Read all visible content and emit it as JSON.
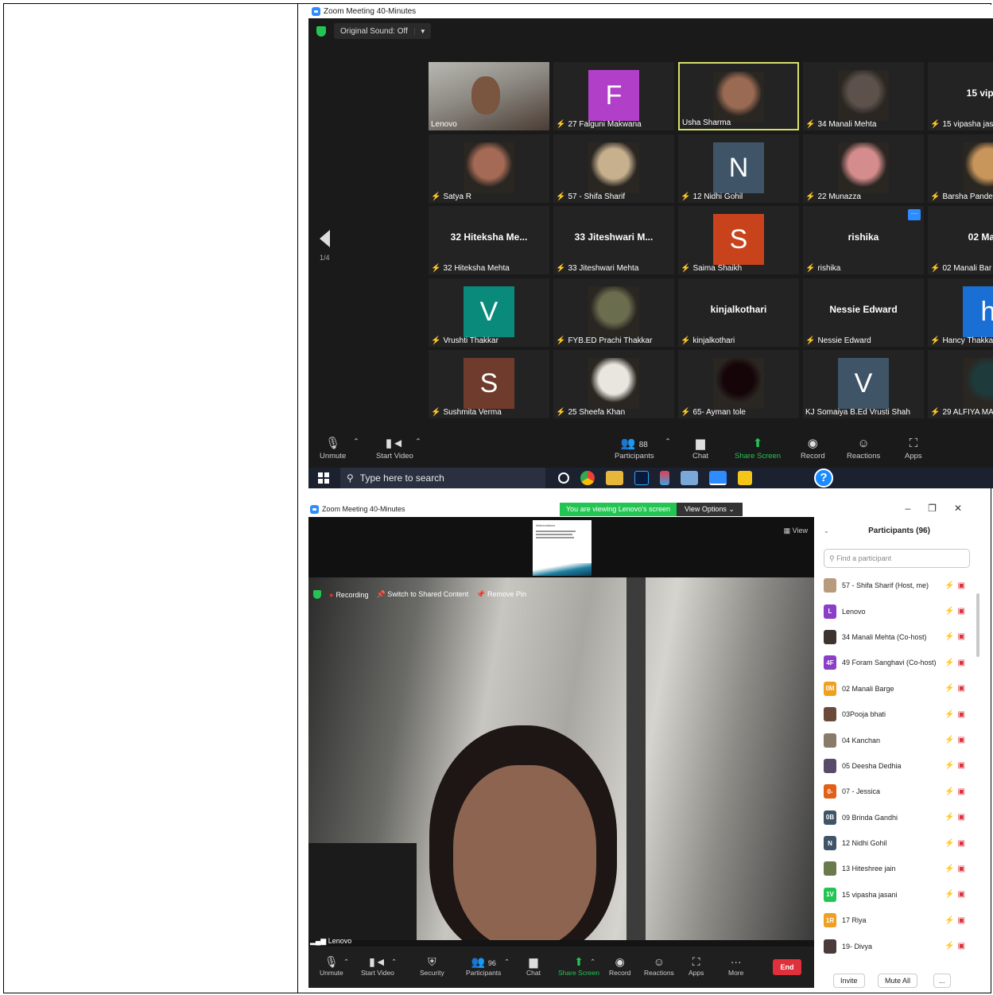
{
  "top": {
    "window_title": "Zoom Meeting 40-Minutes",
    "original_sound": "Original Sound: Off",
    "page_indicator": "1/4",
    "tiles": [
      {
        "name": "Lenovo",
        "kind": "photo-wide",
        "muted": false
      },
      {
        "name": "27 Falguni Makwana",
        "kind": "letter",
        "letter": "F",
        "color": "#b13fc8",
        "muted": true
      },
      {
        "name": "Usha Sharma",
        "kind": "photo",
        "color": "#9a6a52",
        "muted": false,
        "active": true
      },
      {
        "name": "34 Manali Mehta",
        "kind": "photo",
        "color": "#5d514c",
        "muted": true
      },
      {
        "name": "15 vipasha jas",
        "kind": "text",
        "big": "15 vipash",
        "muted": true
      },
      {
        "name": "Satya R",
        "kind": "photo",
        "color": "#a56a55",
        "muted": true
      },
      {
        "name": "57 - Shifa Sharif",
        "kind": "photo",
        "color": "#c7b08e",
        "muted": true
      },
      {
        "name": "12 Nidhi Gohil",
        "kind": "letter",
        "letter": "N",
        "color": "#3f5466",
        "muted": true
      },
      {
        "name": "22 Munazza",
        "kind": "photo",
        "color": "#d48c8c",
        "muted": true
      },
      {
        "name": "Barsha Pande",
        "kind": "photo",
        "color": "#c8955b",
        "muted": true
      },
      {
        "name": "32 Hiteksha Mehta",
        "kind": "text",
        "big": "32 Hiteksha Me...",
        "muted": true
      },
      {
        "name": "33 Jiteshwari Mehta",
        "kind": "text",
        "big": "33 Jiteshwari M...",
        "muted": true
      },
      {
        "name": "Saima Shaikh",
        "kind": "letter",
        "letter": "S",
        "color": "#c8431c",
        "muted": true
      },
      {
        "name": "rishika",
        "kind": "text",
        "big": "rishika",
        "muted": true,
        "more": true
      },
      {
        "name": "02 Manali Bar",
        "kind": "text",
        "big": "02 Manal",
        "muted": true
      },
      {
        "name": "Vrushti Thakkar",
        "kind": "letter",
        "letter": "V",
        "color": "#0a8a7a",
        "muted": true
      },
      {
        "name": "FYB.ED Prachi Thakkar",
        "kind": "photo",
        "color": "#6b6e4e",
        "muted": true
      },
      {
        "name": "kinjalkothari",
        "kind": "text",
        "big": "kinjalkothari",
        "muted": true
      },
      {
        "name": "Nessie Edward",
        "kind": "text",
        "big": "Nessie Edward",
        "muted": true
      },
      {
        "name": "Hancy Thakkar",
        "kind": "letter",
        "letter": "h",
        "color": "#1a6fd4",
        "muted": true
      },
      {
        "name": "Sushmita Verma",
        "kind": "letter",
        "letter": "S",
        "color": "#6e3b2c",
        "muted": true
      },
      {
        "name": "25 Sheefa Khan",
        "kind": "photo",
        "color": "#e8e6df",
        "muted": true
      },
      {
        "name": "65- Ayman tole",
        "kind": "photo",
        "color": "#150508",
        "muted": true
      },
      {
        "name": "KJ Somaiya B.Ed Vrusti Shah",
        "kind": "letter",
        "letter": "V",
        "color": "#3f5466",
        "muted": false
      },
      {
        "name": "29 ALFIYA MA",
        "kind": "photo",
        "color": "#1e3a3a",
        "muted": true
      }
    ],
    "toolbar": {
      "unmute": "Unmute",
      "start_video": "Start Video",
      "participants": "Participants",
      "participants_count": "88",
      "chat": "Chat",
      "share_screen": "Share Screen",
      "record": "Record",
      "reactions": "Reactions",
      "apps": "Apps"
    },
    "taskbar": {
      "search_placeholder": "Type here to search",
      "help": "?"
    }
  },
  "bottom": {
    "window_title": "Zoom Meeting 40-Minutes",
    "viewing_banner": "You are viewing Lenovo's screen",
    "view_options": "View Options",
    "view_label": "View",
    "recording": "Recording",
    "switch_shared": "Switch to Shared Content",
    "remove_pin": "Remove Pin",
    "speaker_label": "Lenovo",
    "shared_doc_title": "Abbreviations",
    "toolbar": {
      "unmute": "Unmute",
      "start_video": "Start Video",
      "security": "Security",
      "participants": "Participants",
      "participants_count": "96",
      "chat": "Chat",
      "share_screen": "Share Screen",
      "record": "Record",
      "reactions": "Reactions",
      "apps": "Apps",
      "more": "More",
      "end": "End"
    },
    "panel": {
      "title": "Participants (96)",
      "search_placeholder": "Find a participant",
      "invite": "Invite",
      "mute_all": "Mute All",
      "more": "...",
      "participants": [
        {
          "name": "57 - Shifa Sharif (Host, me)",
          "initials": "",
          "color": "#b89a7c"
        },
        {
          "name": "Lenovo",
          "initials": "L",
          "color": "#8b3fc8"
        },
        {
          "name": "34 Manali Mehta (Co-host)",
          "initials": "",
          "color": "#3d3430"
        },
        {
          "name": "49 Foram Sanghavi (Co-host)",
          "initials": "4F",
          "color": "#8b3fc8"
        },
        {
          "name": "02 Manali Barge",
          "initials": "0M",
          "color": "#f0a020"
        },
        {
          "name": "03Pooja bhati",
          "initials": "",
          "color": "#6b4a3a"
        },
        {
          "name": "04 Kanchan",
          "initials": "",
          "color": "#8a7a6a"
        },
        {
          "name": "05 Deesha Dedhia",
          "initials": "",
          "color": "#5a4a6a"
        },
        {
          "name": "07 - Jessica",
          "initials": "0-",
          "color": "#e0601a"
        },
        {
          "name": "09 Brinda Gandhi",
          "initials": "0B",
          "color": "#3f5466"
        },
        {
          "name": "12 Nidhi Gohil",
          "initials": "N",
          "color": "#3f5466"
        },
        {
          "name": "13 Hiteshree jain",
          "initials": "",
          "color": "#6b7a4a"
        },
        {
          "name": "15 vipasha jasani",
          "initials": "1V",
          "color": "#23c552"
        },
        {
          "name": "17 Riya",
          "initials": "1R",
          "color": "#f0a020"
        },
        {
          "name": "19- Divya",
          "initials": "",
          "color": "#4a3a3a"
        }
      ]
    }
  }
}
